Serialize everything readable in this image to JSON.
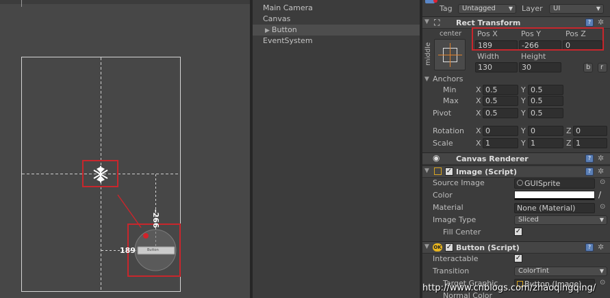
{
  "hierarchy": {
    "items": [
      "Main Camera",
      "Canvas",
      "Button",
      "EventSystem"
    ],
    "selected": "Button"
  },
  "scene": {
    "pos_x_label": "189",
    "pos_y_label": "-266",
    "button_label": "Button"
  },
  "inspector": {
    "tag_label": "Tag",
    "tag_value": "Untagged",
    "layer_label": "Layer",
    "layer_value": "UI",
    "rect_transform": {
      "title": "Rect Transform",
      "anchor_h": "center",
      "anchor_v": "middle",
      "pos_x_label": "Pos X",
      "pos_y_label": "Pos Y",
      "pos_z_label": "Pos Z",
      "pos_x": "189",
      "pos_y": "-266",
      "pos_z": "0",
      "width_label": "Width",
      "height_label": "Height",
      "width": "130",
      "height": "30",
      "blueprint_btn": "b",
      "raw_btn": "r",
      "anchors_label": "Anchors",
      "min_label": "Min",
      "max_label": "Max",
      "pivot_label": "Pivot",
      "x": "X",
      "y": "Y",
      "z": "Z",
      "min_x": "0.5",
      "min_y": "0.5",
      "max_x": "0.5",
      "max_y": "0.5",
      "pivot_x": "0.5",
      "pivot_y": "0.5",
      "rotation_label": "Rotation",
      "rot_x": "0",
      "rot_y": "0",
      "rot_z": "0",
      "scale_label": "Scale",
      "scale_x": "1",
      "scale_y": "1",
      "scale_z": "1"
    },
    "canvas_renderer": {
      "title": "Canvas Renderer"
    },
    "image_script": {
      "title": "Image (Script)",
      "source_image_label": "Source Image",
      "source_image_value": "GUISprite",
      "color_label": "Color",
      "color_value": "#ffffff",
      "material_label": "Material",
      "material_value": "None (Material)",
      "image_type_label": "Image Type",
      "image_type_value": "Sliced",
      "fill_center_label": "Fill Center"
    },
    "button_script": {
      "title": "Button (Script)",
      "interactable_label": "Interactable",
      "transition_label": "Transition",
      "transition_value": "ColorTint",
      "target_graphic_label": "Target Graphic",
      "target_graphic_value": "Button (Image)",
      "normal_color_label": "Normal Color"
    }
  },
  "watermark": "http://www.cnblogs.com/zhaoqingqing/",
  "colors": {
    "highlight_red": "#c9262c",
    "panel_bg": "#3c3c3c",
    "scene_bg": "#474747"
  }
}
